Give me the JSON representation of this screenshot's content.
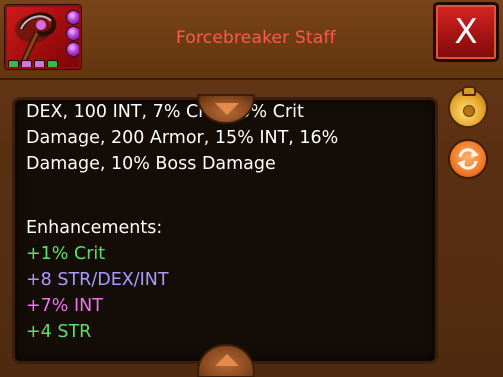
{
  "item": {
    "name": "Forcebreaker Staff",
    "gem_color": "#b43bd2",
    "slot_colors": [
      "#3fb64a",
      "#cf78d8",
      "#cf78d8",
      "#3fb64a"
    ]
  },
  "close_button": {
    "label": "X"
  },
  "description": {
    "line_cut": "DEX, 100 INT, 7% Crit, 15% Crit",
    "line_2": "Damage, 200 Armor, 15% INT, 16%",
    "line_3": "Damage, 10% Boss Damage"
  },
  "enhancements": {
    "title": "Enhancements:",
    "items": [
      {
        "text": "+1% Crit",
        "color": "#5fe06a"
      },
      {
        "text": "+8 STR/DEX/INT",
        "color": "#a79cff"
      },
      {
        "text": "+7% INT",
        "color": "#ef72ef"
      },
      {
        "text": "+4 STR",
        "color": "#5fe06a"
      }
    ]
  },
  "side_buttons": [
    {
      "icon": "gold-bag-icon"
    },
    {
      "icon": "swap-arrows-icon"
    }
  ],
  "colors": {
    "title_red": "#ff5a4e",
    "panel_bg": "#140c06",
    "frame_brown": "#5a3012"
  }
}
